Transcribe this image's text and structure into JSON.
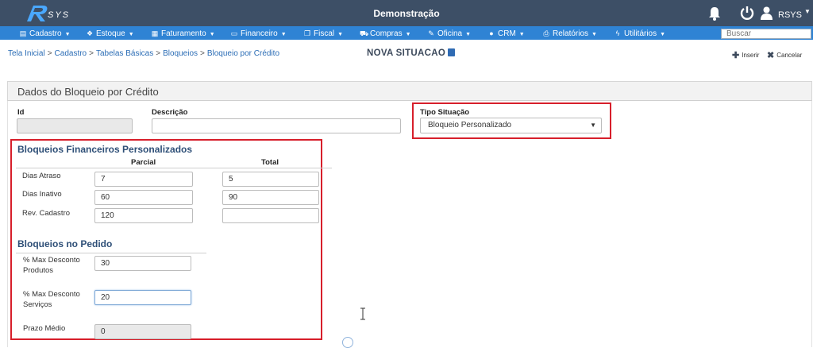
{
  "header": {
    "logo_text": "RSYS",
    "app_title": "Demonstração",
    "user_name": "RSYS",
    "icons": [
      "bell-icon",
      "power-icon",
      "user-icon"
    ]
  },
  "menu": {
    "items": [
      {
        "label": "Cadastro",
        "icon": "book-icon"
      },
      {
        "label": "Estoque",
        "icon": "cubes-icon"
      },
      {
        "label": "Faturamento",
        "icon": "calculator-icon"
      },
      {
        "label": "Financeiro",
        "icon": "money-icon"
      },
      {
        "label": "Fiscal",
        "icon": "copy-icon"
      },
      {
        "label": "Compras",
        "icon": "truck-icon"
      },
      {
        "label": "Oficina",
        "icon": "wrench-icon"
      },
      {
        "label": "CRM",
        "icon": "users-icon"
      },
      {
        "label": "Relatórios",
        "icon": "print-icon"
      },
      {
        "label": "Utilitários",
        "icon": "bolt-icon"
      }
    ],
    "search_value": "Buscar"
  },
  "breadcrumb": {
    "items": [
      "Tela Inicial",
      "Cadastro",
      "Tabelas Básicas",
      "Bloqueios",
      "Bloqueio por Crédito"
    ],
    "separator": ">"
  },
  "page": {
    "title": "NOVA SITUACAO",
    "insert_label": "Inserir",
    "cancel_label": "Cancelar"
  },
  "panel": {
    "title": "Dados do Bloqueio por Crédito",
    "id_label": "Id",
    "id_value": "",
    "descricao_label": "Descrição",
    "descricao_value": "",
    "tipo_label": "Tipo Situação",
    "tipo_value": "Bloqueio Personalizado"
  },
  "financeiros": {
    "title": "Bloqueios Financeiros Personalizados",
    "col_parcial": "Parcial",
    "col_total": "Total",
    "rows": [
      {
        "label": "Dias Atraso",
        "parcial": "7",
        "total": "5"
      },
      {
        "label": "Dias Inativo",
        "parcial": "60",
        "total": "90"
      },
      {
        "label": "Rev. Cadastro",
        "parcial": "120",
        "total": ""
      }
    ]
  },
  "pedido": {
    "title": "Bloqueios no Pedido",
    "rows": [
      {
        "label": "% Max Desconto Produtos",
        "value": "30"
      },
      {
        "label": "% Max Desconto Serviços",
        "value": "20"
      },
      {
        "label": "Prazo Médio",
        "value": "0"
      }
    ]
  },
  "colors": {
    "topbar": "#3d4f66",
    "menubar": "#2f83d4",
    "highlight": "#d71f2b",
    "section_title": "#2e4f77"
  }
}
